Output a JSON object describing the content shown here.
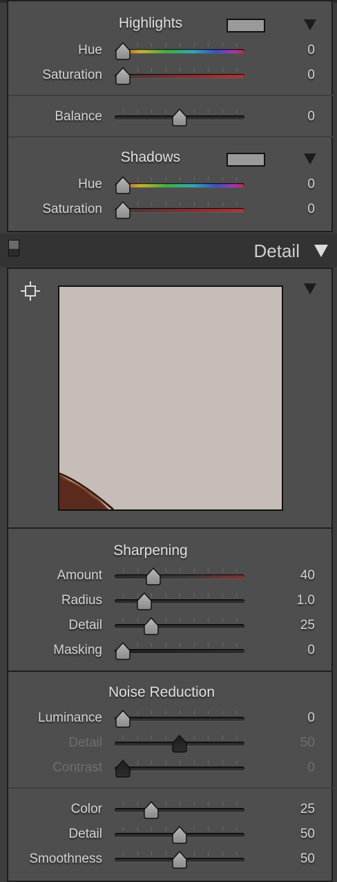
{
  "split_toning": {
    "highlights": {
      "title": "Highlights",
      "hue": {
        "label": "Hue",
        "value": "0",
        "pos": 0
      },
      "saturation": {
        "label": "Saturation",
        "value": "0",
        "pos": 0
      }
    },
    "balance": {
      "label": "Balance",
      "value": "0",
      "pos": 0.5
    },
    "shadows": {
      "title": "Shadows",
      "hue": {
        "label": "Hue",
        "value": "0",
        "pos": 0
      },
      "saturation": {
        "label": "Saturation",
        "value": "0",
        "pos": 0
      }
    }
  },
  "detail_header": {
    "title": "Detail"
  },
  "sharpening": {
    "title": "Sharpening",
    "amount": {
      "label": "Amount",
      "value": "40",
      "pos": 0.27
    },
    "radius": {
      "label": "Radius",
      "value": "1.0",
      "pos": 0.19
    },
    "detail": {
      "label": "Detail",
      "value": "25",
      "pos": 0.25
    },
    "masking": {
      "label": "Masking",
      "value": "0",
      "pos": 0
    }
  },
  "noise_reduction": {
    "title": "Noise Reduction",
    "luminance": {
      "label": "Luminance",
      "value": "0",
      "pos": 0
    },
    "lum_detail": {
      "label": "Detail",
      "value": "50",
      "pos": 0.5
    },
    "lum_contrast": {
      "label": "Contrast",
      "value": "0",
      "pos": 0
    },
    "color": {
      "label": "Color",
      "value": "25",
      "pos": 0.25
    },
    "color_detail": {
      "label": "Detail",
      "value": "50",
      "pos": 0.5
    },
    "smoothness": {
      "label": "Smoothness",
      "value": "50",
      "pos": 0.5
    }
  },
  "colors": {
    "panel": "#4e4e4e",
    "background": "#3d3d3d",
    "swatch": "#9a9a9a",
    "preview": "#c6bdb8"
  },
  "icons": {
    "target": "crosshair-target-icon",
    "disclosure": "triangle-down-icon"
  }
}
